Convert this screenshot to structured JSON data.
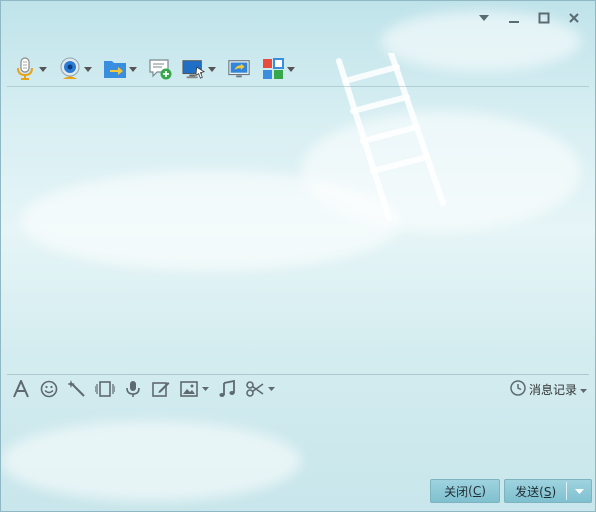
{
  "window": {
    "controls": {
      "menu_icon": "dropdown-triangle-icon",
      "minimize_icon": "minimize-icon",
      "maximize_icon": "maximize-icon",
      "close_icon": "close-x-icon"
    }
  },
  "toolbar": {
    "items": [
      {
        "icon": "microphone-icon",
        "has_dropdown": true
      },
      {
        "icon": "webcam-icon",
        "has_dropdown": true
      },
      {
        "icon": "send-file-folder-icon",
        "has_dropdown": true
      },
      {
        "icon": "chat-add-icon",
        "has_dropdown": false
      },
      {
        "icon": "remote-desktop-icon",
        "has_dropdown": true
      },
      {
        "icon": "screen-share-icon",
        "has_dropdown": false
      },
      {
        "icon": "app-grid-icon",
        "has_dropdown": true
      }
    ]
  },
  "input_toolbar": {
    "items": [
      {
        "icon": "font-icon"
      },
      {
        "icon": "emoji-smile-icon"
      },
      {
        "icon": "magic-wand-icon"
      },
      {
        "icon": "shake-window-icon"
      },
      {
        "icon": "voice-message-icon"
      },
      {
        "icon": "edit-note-icon"
      },
      {
        "icon": "image-icon",
        "has_dropdown": true
      },
      {
        "icon": "music-note-icon"
      },
      {
        "icon": "scissors-screenshot-icon",
        "has_dropdown": true
      }
    ],
    "history": {
      "icon": "clock-icon",
      "label": "消息记录"
    }
  },
  "buttons": {
    "close": {
      "label": "关闭",
      "hotkey": "C"
    },
    "send": {
      "label": "发送",
      "hotkey": "S"
    }
  },
  "colors": {
    "button_bg": "#8fcad8",
    "accent_blue": "#2b7bd6"
  }
}
